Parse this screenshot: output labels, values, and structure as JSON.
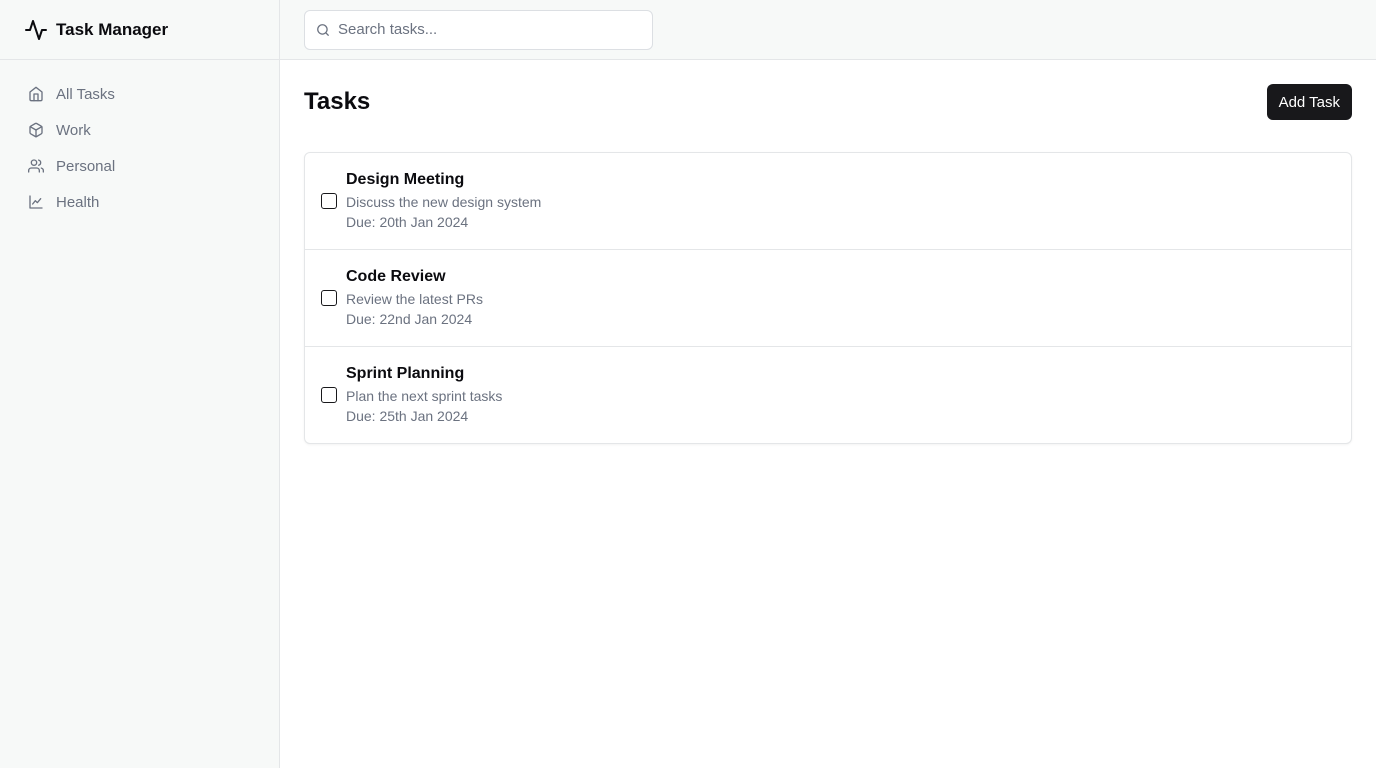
{
  "app": {
    "title": "Task Manager",
    "logo_icon": "activity-icon"
  },
  "sidebar": {
    "items": [
      {
        "label": "All Tasks",
        "icon": "home-icon"
      },
      {
        "label": "Work",
        "icon": "package-icon"
      },
      {
        "label": "Personal",
        "icon": "users-icon"
      },
      {
        "label": "Health",
        "icon": "line-chart-icon"
      }
    ]
  },
  "search": {
    "placeholder": "Search tasks...",
    "value": ""
  },
  "main": {
    "title": "Tasks",
    "add_button_label": "Add Task",
    "tasks": [
      {
        "title": "Design Meeting",
        "description": "Discuss the new design system",
        "due": "Due: 20th Jan 2024",
        "checked": false
      },
      {
        "title": "Code Review",
        "description": "Review the latest PRs",
        "due": "Due: 22nd Jan 2024",
        "checked": false
      },
      {
        "title": "Sprint Planning",
        "description": "Plan the next sprint tasks",
        "due": "Due: 25th Jan 2024",
        "checked": false
      }
    ]
  },
  "colors": {
    "sidebar_bg": "#f7f9f8",
    "border": "#e4e6e8",
    "muted_text": "#6b7280",
    "primary_button": "#18181b"
  }
}
